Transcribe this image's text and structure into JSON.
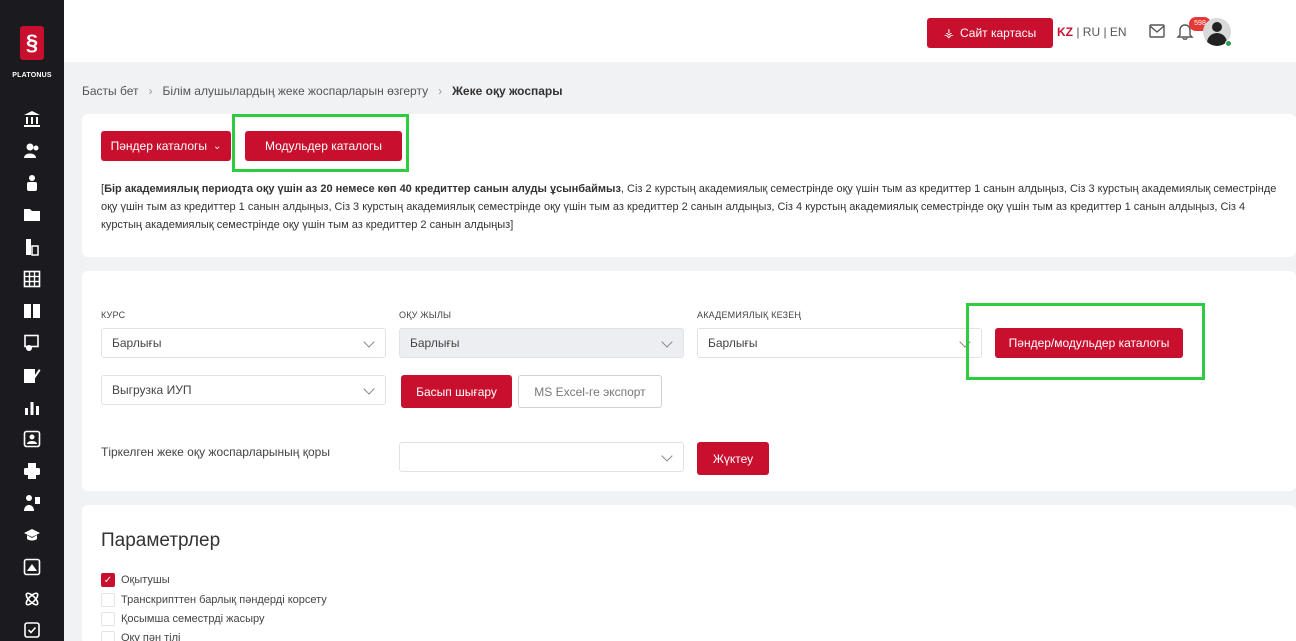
{
  "app": {
    "logo_text": "PLATONUS"
  },
  "sidebar": {
    "icons": [
      "bank-icon",
      "users-icon",
      "student-icon",
      "folder-icon",
      "document-icon",
      "grid-icon",
      "book-icon",
      "certificate-icon",
      "edit-icon",
      "chart-icon",
      "portrait-icon",
      "printer-icon",
      "teacher-icon",
      "graduation-cap-icon",
      "monitor-icon",
      "atom-icon",
      "calendar-icon"
    ]
  },
  "topbar": {
    "sitemap_label": "Сайт картасы",
    "lang_kz": "KZ",
    "lang_rest": " | RU | EN",
    "notifications_count": "598"
  },
  "breadcrumb": {
    "home": "Басты бет",
    "parent": "Білім алушылардың жеке жоспарларын өзгерту",
    "current": "Жеке оқу жоспары"
  },
  "catalog": {
    "subjects_catalog_label": "Пәндер каталогы",
    "modules_catalog_label": "Модульдер каталогы",
    "info_bold": "Бір академиялық периодта оқу үшін аз 20 немесе көп 40 кредиттер санын алуды ұсынбаймыз",
    "info_rest": ", Сіз 2 курстың академиялық семестрінде оқу үшін тым аз кредиттер 1 санын алдыңыз, Сіз 3 курстың академиялық семестрінде оқу үшін тым аз кредиттер 1 санын алдыңыз, Сіз 3 курстың академиялық семестрінде оқу үшін тым аз кредиттер 2 санын алдыңыз, Сіз 4 курстың академиялық семестрінде оқу үшін тым аз кредиттер 1 санын алдыңыз, Сіз 4 курстың академиялық семестрінде оқу үшін тым аз кредиттер 2 санын алдыңыз]",
    "info_open": "["
  },
  "filters": {
    "course_label": "КУРС",
    "course_value": "Барлығы",
    "year_label": "ОҚУ ЖЫЛЫ",
    "year_value": "Барлығы",
    "period_label": "АКАДЕМИЯЛЫҚ КЕЗЕҢ",
    "period_value": "Барлығы",
    "subjects_modules_catalog_label": "Пәндер/модульдер каталогы",
    "export_select_value": "Выгрузка ИУП",
    "print_label": "Басып шығару",
    "excel_label": "MS Excel-ге экспорт",
    "registered_plans_label": "Тіркелген жеке оқу жоспарларының қоры",
    "registered_plans_value": "",
    "load_label": "Жүктеу"
  },
  "parameters": {
    "title": "Параметрлер",
    "options": [
      {
        "label": "Оқытушы",
        "checked": true
      },
      {
        "label": "Транскрипттен барлық пәндерді корсету",
        "checked": false
      },
      {
        "label": "Қосымша семестрді жасыру",
        "checked": false
      },
      {
        "label": "Оқу пән тілі",
        "checked": false
      }
    ]
  }
}
